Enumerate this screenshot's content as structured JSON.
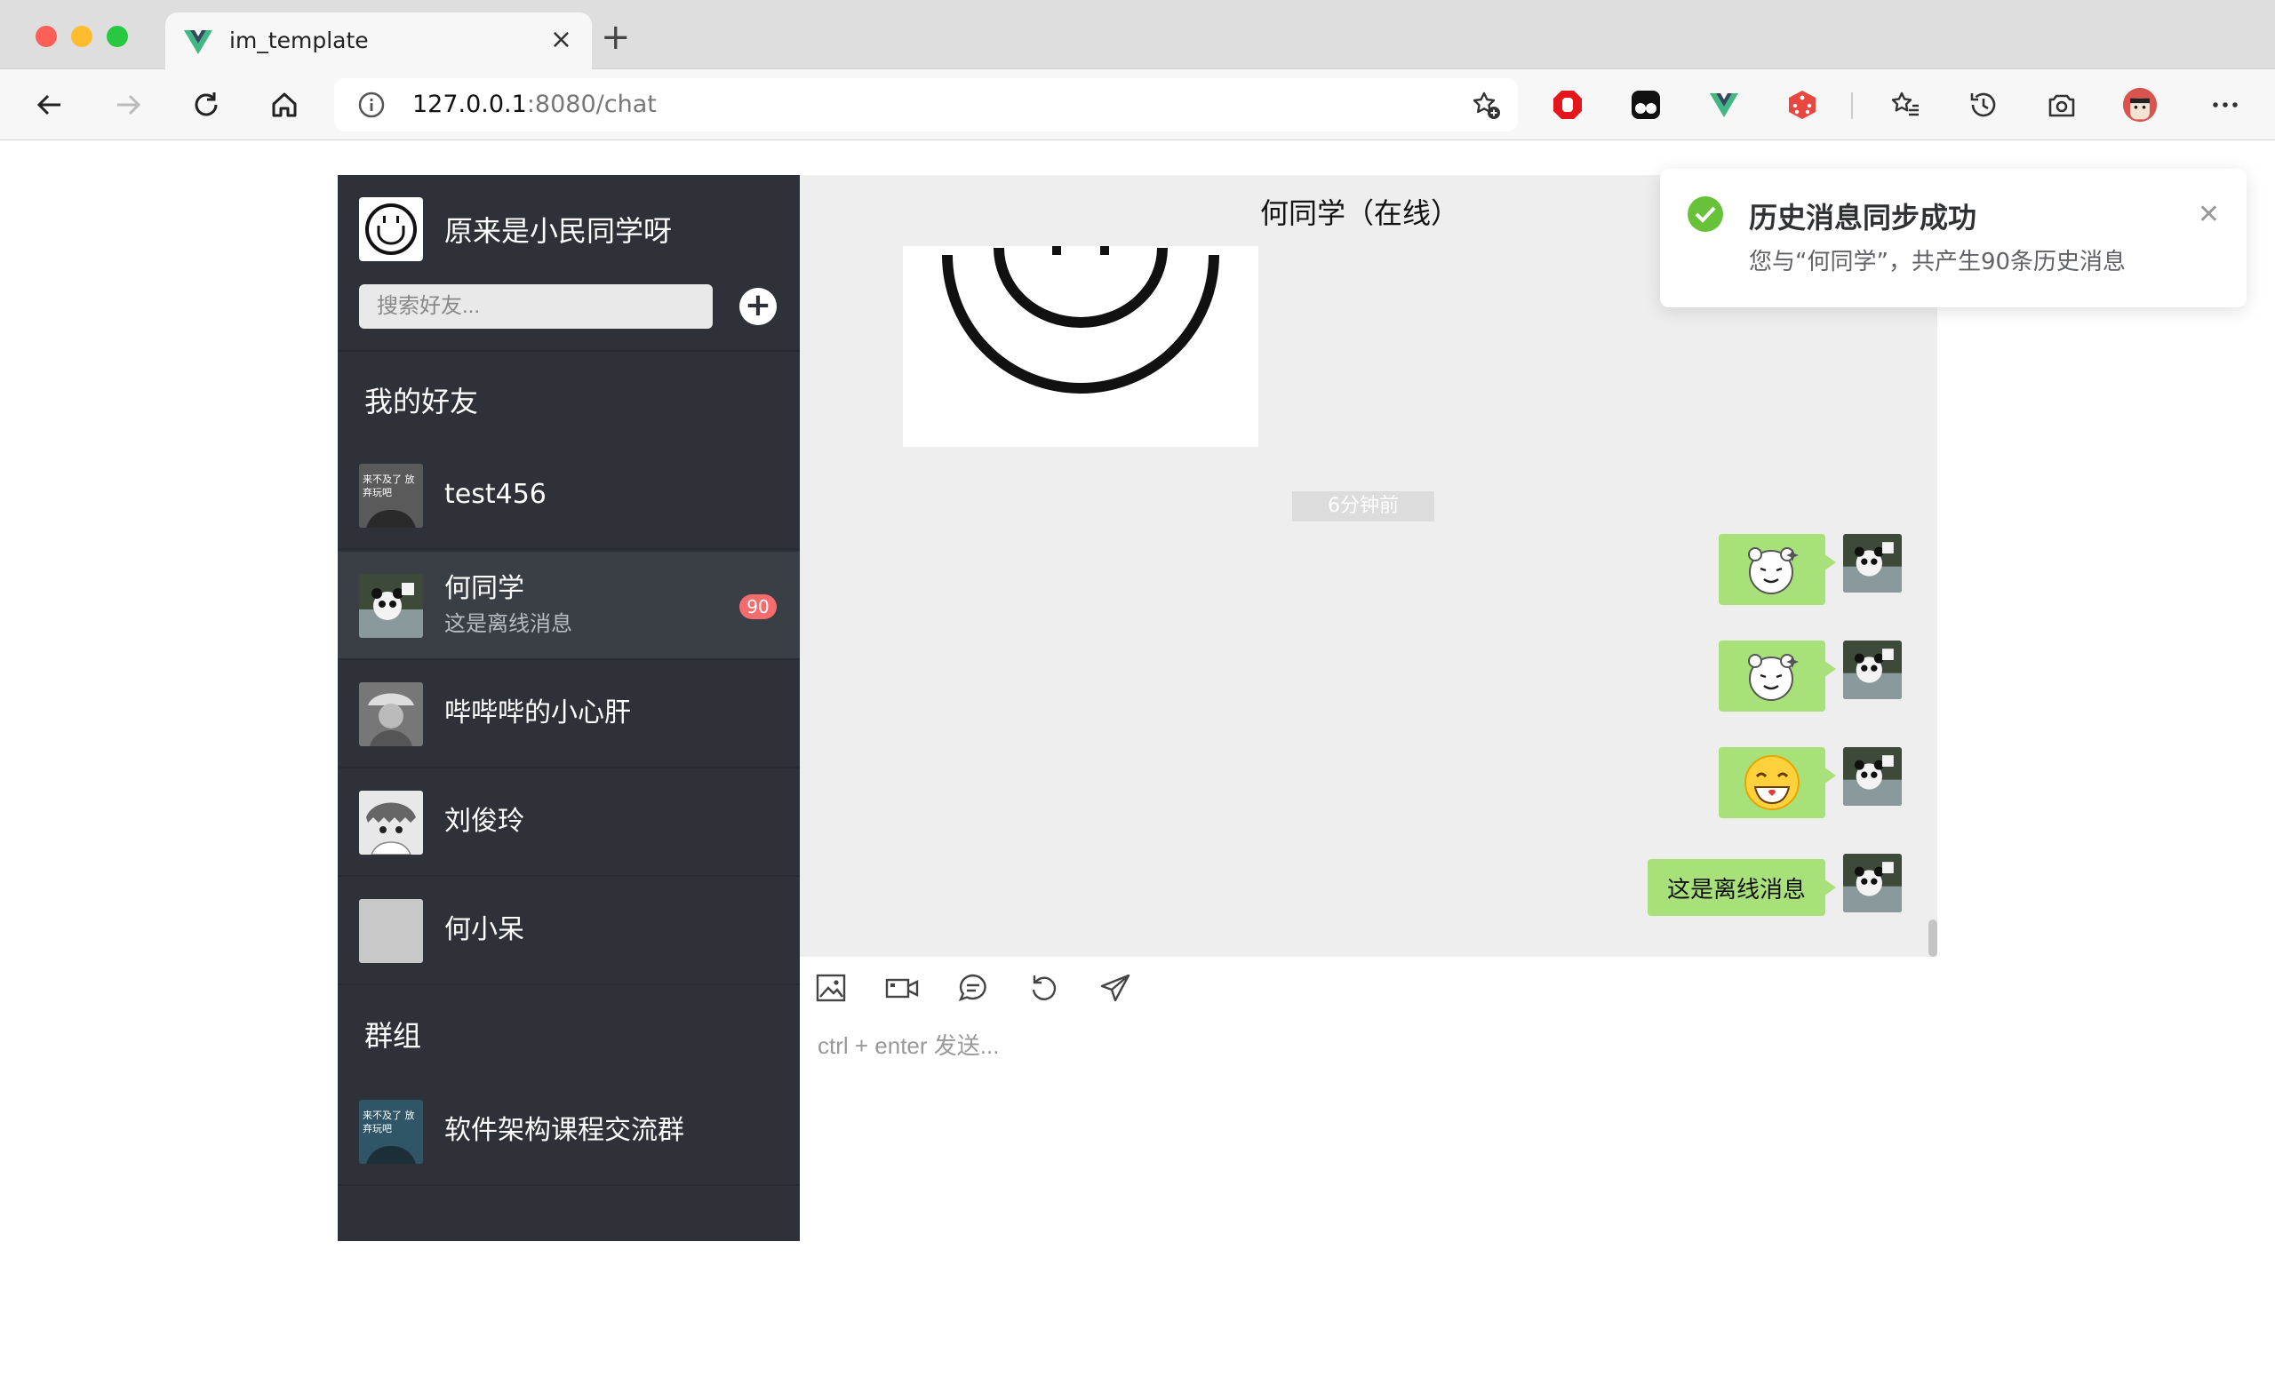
{
  "browser": {
    "tab_title": "im_template",
    "address_host": "127.0.0.1",
    "address_rest": ":8080/chat"
  },
  "sidebar": {
    "my_name": "原来是小民同学呀",
    "search_placeholder": "搜索好友...",
    "friends_title": "我的好友",
    "groups_title": "群组",
    "friends": [
      {
        "name": "test456",
        "preview": "",
        "badge": ""
      },
      {
        "name": "何同学",
        "preview": "这是离线消息",
        "badge": "90"
      },
      {
        "name": "哔哔哔的小心肝",
        "preview": "",
        "badge": ""
      },
      {
        "name": "刘俊玲",
        "preview": "",
        "badge": ""
      },
      {
        "name": "何小呆",
        "preview": "",
        "badge": ""
      }
    ],
    "groups": [
      {
        "name": "软件架构课程交流群"
      }
    ],
    "avatar_text": "来不及了 放弃玩吧"
  },
  "chat": {
    "title": "何同学（在线）",
    "timestamp": "6分钟前",
    "last_text": "这是离线消息",
    "input_placeholder": "ctrl + enter 发送..."
  },
  "notification": {
    "title": "历史消息同步成功",
    "body": "您与“何同学”，共产生90条历史消息",
    "accent": "#67c23a"
  },
  "colors": {
    "sidebar_bg": "#2e3238",
    "bubble": "#a8e07a",
    "badge": "#f56c6c"
  }
}
